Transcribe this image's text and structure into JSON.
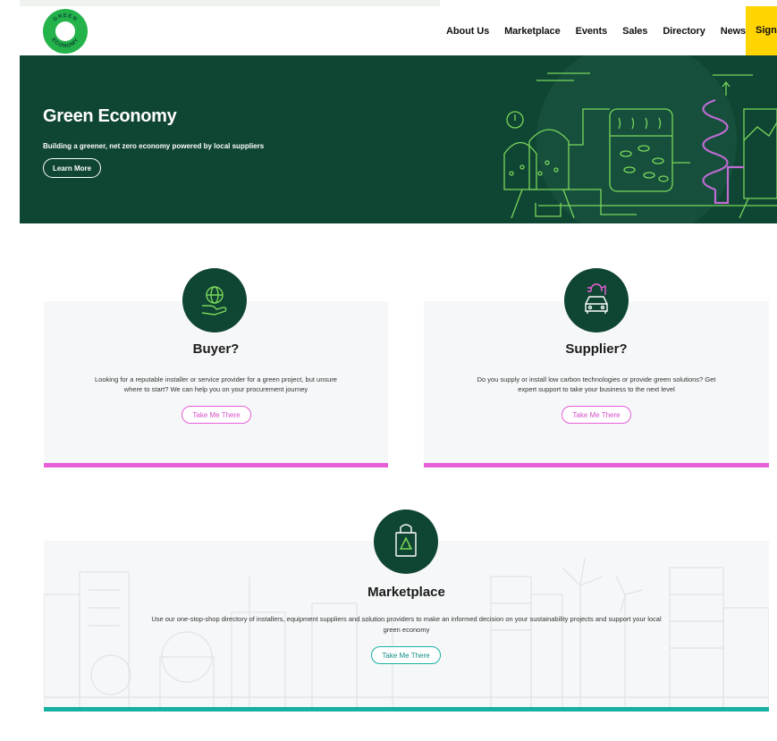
{
  "header": {
    "logo_text": "GREEN ECONOMY",
    "nav": [
      "About Us",
      "Marketplace",
      "Events",
      "Sales",
      "Directory",
      "News"
    ],
    "signin_label": "Sign In"
  },
  "hero": {
    "title": "Green Economy",
    "subtitle": "Building a greener, net zero economy powered by local suppliers",
    "button": "Learn More"
  },
  "cards": {
    "buyer": {
      "title": "Buyer?",
      "desc_line1": "Looking for a reputable installer or service provider for a green project, but unsure",
      "desc_line2": "where to start? We can help you on your procurement journey",
      "button": "Take Me There",
      "icon": "globe-hand-icon"
    },
    "supplier": {
      "title": "Supplier?",
      "desc_line1": "Do you supply or install low carbon technologies or provide green solutions? Get",
      "desc_line2": "expert support to take your business to the next level",
      "button": "Take Me There",
      "icon": "electric-car-icon"
    },
    "marketplace": {
      "title": "Marketplace",
      "desc_line1": "Use our one-stop-shop directory of installers, equipment suppliers and solution providers to make an informed decision on your sustainability projects and support your local",
      "desc_line2": "green economy",
      "button": "Take Me There",
      "icon": "recycle-bag-icon"
    }
  },
  "colors": {
    "brand_green": "#24b24b",
    "hero_dark": "#0f4533",
    "pink_accent": "#e65fd7",
    "teal_accent": "#17b0a3",
    "signin_yellow": "#ffd400"
  }
}
